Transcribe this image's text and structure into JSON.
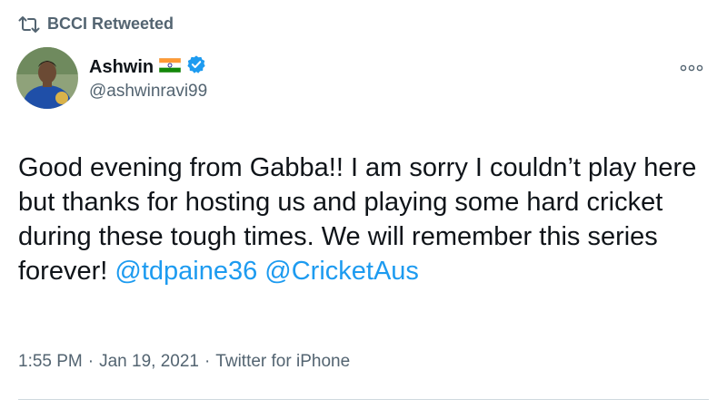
{
  "retweet": {
    "icon": "retweet-icon",
    "label": "BCCI Retweeted"
  },
  "author": {
    "name": "Ashwin",
    "handle": "@ashwinravi99",
    "flag_icon": "india-flag-icon",
    "verified_icon": "verified-badge-icon",
    "avatar_icon": "avatar"
  },
  "more_icon": "more-options-icon",
  "tweet": {
    "text": "Good evening from Gabba!! I am sorry I couldn’t play here but thanks for hosting us and playing some hard cricket during these tough times. We will remember this series forever!",
    "mention1": "@tdpaine36",
    "mention2": "@CricketAus"
  },
  "meta": {
    "time": "1:55 PM",
    "separator": "·",
    "date": "Jan 19, 2021",
    "source": "Twitter for iPhone"
  },
  "colors": {
    "link": "#1d9bf0",
    "secondary_text": "#536471",
    "verified": "#1d9bf0"
  }
}
